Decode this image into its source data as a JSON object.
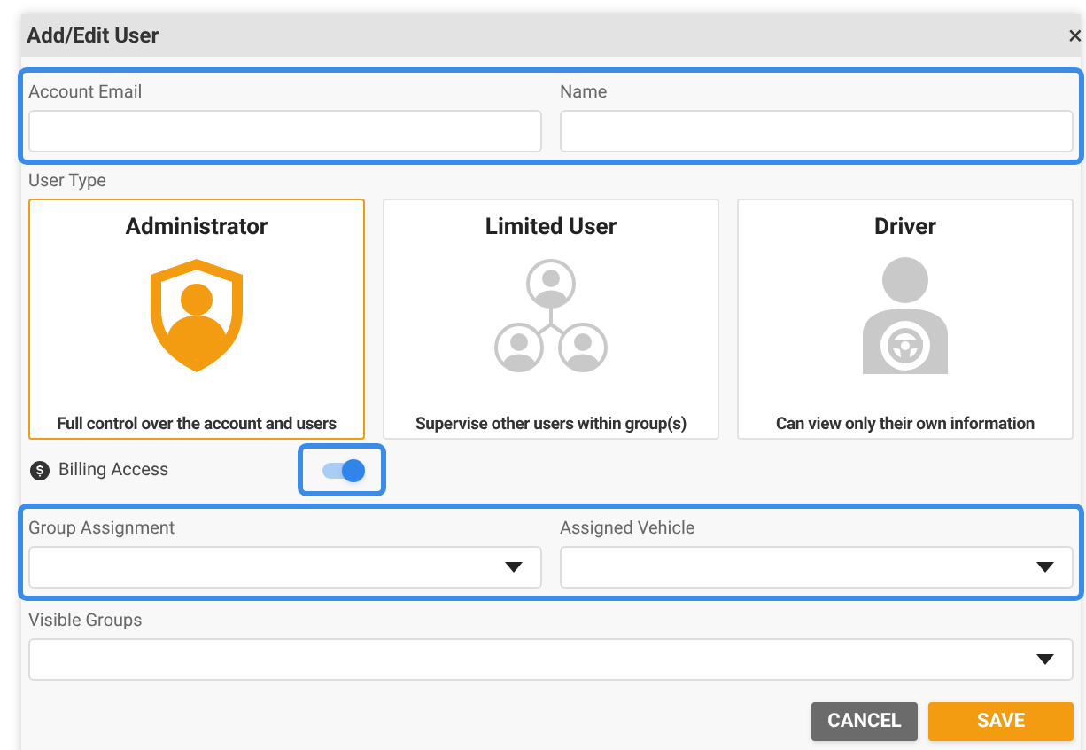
{
  "window": {
    "title": "Add/Edit User",
    "close": "×"
  },
  "account_fields": {
    "highlighted": true,
    "fields": [
      {
        "label": "Account Email",
        "kind": "text"
      },
      {
        "label": "Name",
        "kind": "text"
      }
    ]
  },
  "user_type": {
    "label": "User Type",
    "options": [
      {
        "title": "Administrator",
        "description": "Full control over the account and users",
        "kind": "admin",
        "selected": true
      },
      {
        "title": "Limited User",
        "description": "Supervise other users within group(s)",
        "kind": "limited",
        "selected": false
      },
      {
        "title": "Driver",
        "description": "Can view only their own information",
        "kind": "driver",
        "selected": false
      }
    ]
  },
  "billing_access": {
    "label": "Billing Access",
    "on": true,
    "highlighted": true
  },
  "assignment_fields": {
    "highlighted": true,
    "fields": [
      {
        "label": "Group Assignment",
        "kind": "select"
      },
      {
        "label": "Assigned Vehicle",
        "kind": "select"
      }
    ]
  },
  "visible_groups": {
    "label": "Visible Groups",
    "kind": "select"
  },
  "buttons": [
    {
      "label": "CANCEL",
      "kind": "secondary"
    },
    {
      "label": "SAVE",
      "kind": "primary"
    }
  ]
}
